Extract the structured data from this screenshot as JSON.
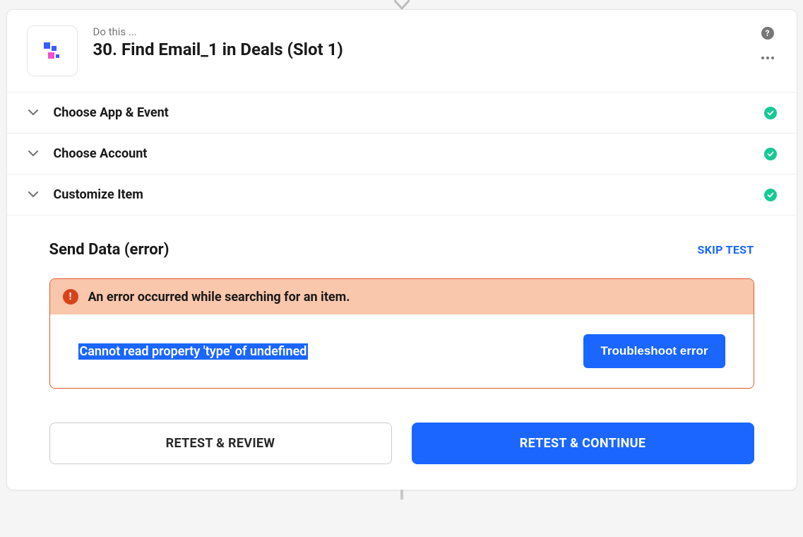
{
  "header": {
    "subtitle": "Do this ...",
    "title": "30. Find Email_1 in Deals (Slot 1)"
  },
  "sections": [
    {
      "label": "Choose App & Event"
    },
    {
      "label": "Choose Account"
    },
    {
      "label": "Customize Item"
    }
  ],
  "sendData": {
    "title": "Send Data (error)",
    "skip_label": "SKIP TEST",
    "error_title": "An error occurred while searching for an item.",
    "error_message": "Cannot read property 'type' of undefined",
    "troubleshoot_label": "Troubleshoot error"
  },
  "buttons": {
    "retest_review": "RETEST & REVIEW",
    "retest_continue": "RETEST & CONTINUE"
  }
}
